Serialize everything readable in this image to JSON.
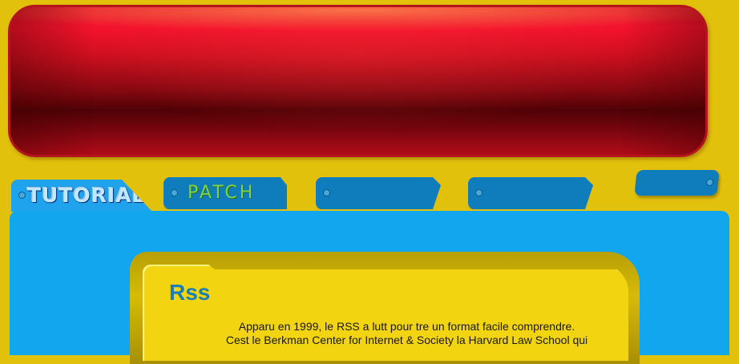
{
  "tabs": [
    {
      "label": "TUTORIAL"
    },
    {
      "label": "PATCH"
    },
    {
      "label": ""
    },
    {
      "label": ""
    },
    {
      "label": ""
    }
  ],
  "article": {
    "title": "Rss",
    "line1": "Apparu en 1999, le RSS a lutt pour tre un format facile comprendre.",
    "line2": "Cest le Berkman Center for Internet & Society la Harvard Law School qui"
  },
  "colors": {
    "page_background": "#e2c10d",
    "banner_red": "#e0102a",
    "tab_blue": "#0f7cbc",
    "active_tab_blue": "#1fa3ec",
    "content_blue": "#12a6ee",
    "panel_yellow": "#f2d410",
    "title_blue": "#1a7fb4"
  }
}
